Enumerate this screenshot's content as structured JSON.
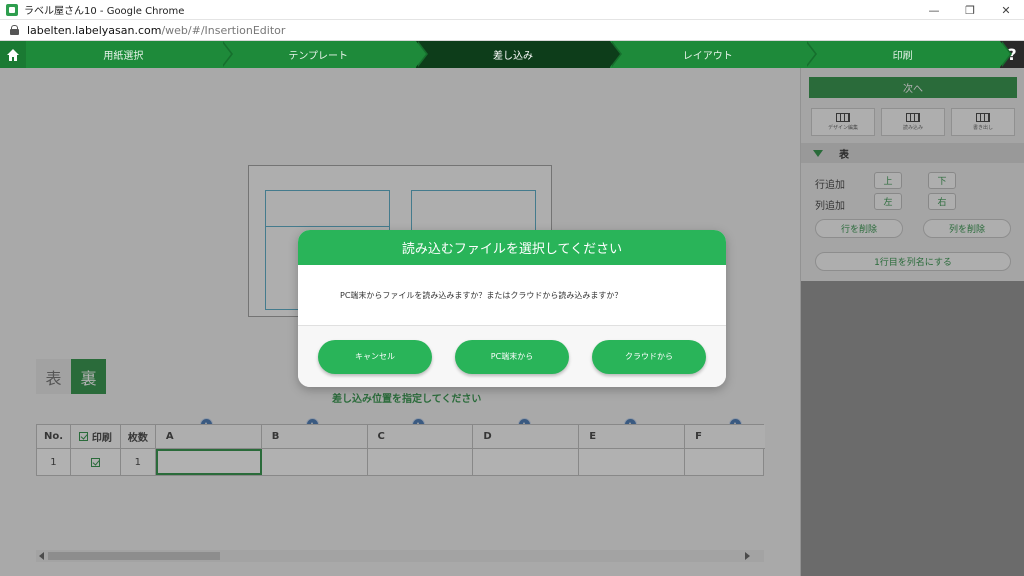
{
  "window": {
    "title": "ラベル屋さん10 - Google Chrome",
    "minimize": "—",
    "restore": "❐",
    "close": "✕"
  },
  "address": {
    "domain": "labelten.labelyasan.com",
    "path": "/web/#/InsertionEditor"
  },
  "steps": [
    {
      "label": "用紙選択"
    },
    {
      "label": "テンプレート"
    },
    {
      "label": "差し込み"
    },
    {
      "label": "レイアウト"
    },
    {
      "label": "印刷"
    }
  ],
  "help_label": "?",
  "side_toggle": {
    "front": "表",
    "back": "裏"
  },
  "instruction": "差し込み位置を指定してください",
  "grid": {
    "headers": {
      "no": "No.",
      "print": "印刷",
      "count": "枚数",
      "cols": [
        "A",
        "B",
        "C",
        "D",
        "E",
        "F"
      ]
    },
    "rows": [
      {
        "no": "1",
        "count": "1"
      }
    ]
  },
  "right_panel": {
    "next": "次へ",
    "tools": [
      "デザイン編集",
      "読み込み",
      "書き出し"
    ],
    "section_title": "表",
    "row_add": "行追加",
    "col_add": "列追加",
    "up": "上",
    "down": "下",
    "left": "左",
    "right": "右",
    "delete_row": "行を削除",
    "delete_col": "列を削除",
    "first_row_header": "1行目を列名にする"
  },
  "modal": {
    "title": "読み込むファイルを選択してください",
    "message": "PC端末からファイルを読み込みますか？またはクラウドから読み込みますか？",
    "buttons": {
      "cancel": "キャンセル",
      "pc": "PC端末から",
      "cloud": "クラウドから"
    }
  },
  "colors": {
    "brand": "#1e8a3a",
    "modal_green": "#29b459",
    "active_step": "#0d3d1a"
  }
}
